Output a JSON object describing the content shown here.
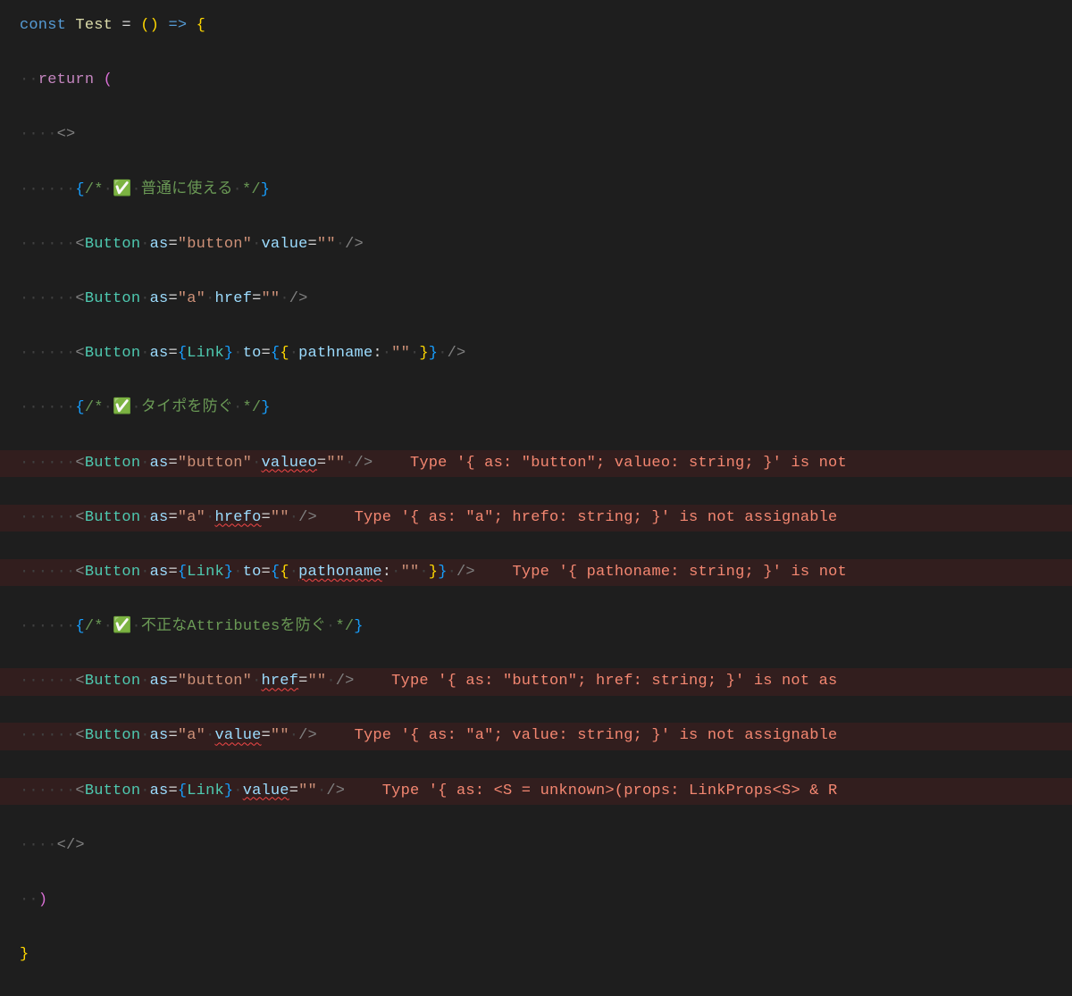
{
  "code": {
    "decl": {
      "const": "const ",
      "name": "Test",
      "eq": " = ",
      "arrow": "() => ",
      "open": "{"
    },
    "ret": {
      "kw": "return ",
      "paren": "("
    },
    "frag_open": "<>",
    "frag_close": "</>",
    "comments": {
      "normal": "{/* ✅ 普通に使える */}",
      "typo": "{/* ✅ タイポを防ぐ */}",
      "invalid": "{/* ✅ 不正なAttributesを防ぐ */}"
    },
    "lines": {
      "btn_button_value": {
        "as": "\"button\"",
        "attr": "value",
        "val": "\"\""
      },
      "btn_a_href": {
        "as": "\"a\"",
        "attr": "href",
        "val": "\"\""
      },
      "btn_link_to": {
        "as": "Link",
        "obj_key": "pathname",
        "obj_val": "\"\""
      },
      "err_button_valueo": {
        "as": "\"button\"",
        "attr": "valueo",
        "val": "\"\"",
        "msg": "Type '{ as: \"button\"; valueo: string; }' is not"
      },
      "err_a_hrefo": {
        "as": "\"a\"",
        "attr": "hrefo",
        "val": "\"\"",
        "msg": "Type '{ as: \"a\"; hrefo: string; }' is not assignable"
      },
      "err_link_pathoname": {
        "as": "Link",
        "obj_key": "pathoname",
        "obj_val": "\"\"",
        "msg": "Type '{ pathoname: string; }' is not"
      },
      "err_button_href": {
        "as": "\"button\"",
        "attr": "href",
        "val": "\"\"",
        "msg": "Type '{ as: \"button\"; href: string; }' is not as"
      },
      "err_a_value": {
        "as": "\"a\"",
        "attr": "value",
        "val": "\"\"",
        "msg": "Type '{ as: \"a\"; value: string; }' is not assignable"
      },
      "err_link_value": {
        "as": "Link",
        "attr": "value",
        "val": "\"\"",
        "msg": "Type '{ as: <S = unknown>(props: LinkProps<S> & R"
      }
    },
    "close_paren": ")",
    "close_brace": "}"
  },
  "tag": "Button",
  "indent": {
    "d1": "··",
    "d2": "····",
    "d3": "······"
  }
}
